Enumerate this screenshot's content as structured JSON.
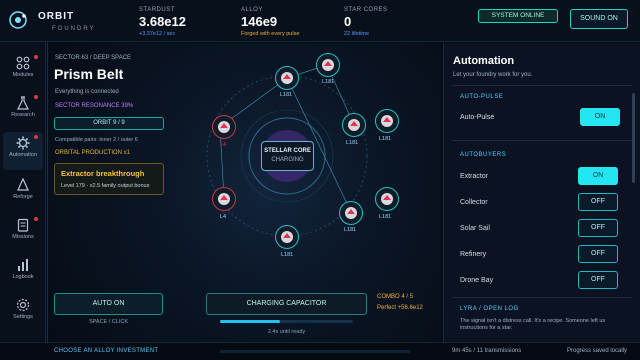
{
  "brand": {
    "name": "ORBIT",
    "subtitle": "FOUNDRY"
  },
  "stats": [
    {
      "label": "STARDUST",
      "value": "3.68e12",
      "sub": "+3.37e12 / sec",
      "sub_color": "#4f9bff"
    },
    {
      "label": "ALLOY",
      "value": "146e9",
      "sub": "Forged with every pulse",
      "sub_color": "#f0b13c"
    },
    {
      "label": "STAR CORES",
      "value": "0",
      "sub": "22 lifetime",
      "sub_color": "#4f9bff"
    }
  ],
  "header_buttons": {
    "status": "SYSTEM ONLINE",
    "sound": "SOUND ON"
  },
  "nav": [
    {
      "label": "Modules",
      "icon": "grid-icon",
      "badge": true
    },
    {
      "label": "Research",
      "icon": "flask-icon",
      "badge": true
    },
    {
      "label": "Automation",
      "icon": "gear-icon",
      "badge": true
    },
    {
      "label": "Reforge",
      "icon": "reforge-icon",
      "badge": false
    },
    {
      "label": "Missions",
      "icon": "clipboard-icon",
      "badge": true
    },
    {
      "label": "Logbook",
      "icon": "bar-chart-icon",
      "badge": false
    },
    {
      "label": "Settings",
      "icon": "settings-icon",
      "badge": false
    }
  ],
  "sector": {
    "label": "SECTOR 63 / DEEP SPACE",
    "title": "Prism Belt",
    "status": "Everything is connected",
    "resonance": "SECTOR RESONANCE 39%",
    "orbit_button": "ORBIT 9 / 9",
    "compat": "Compatible pairs: inner 2 / outer 6",
    "production": "ORBITAL PRODUCTION x1"
  },
  "breakthrough": {
    "title": "Extractor breakthrough",
    "detail": "Level 179 · x2.5 family output bonus"
  },
  "core": {
    "title": "STELLAR CORE",
    "state": "CHARGING"
  },
  "modules": [
    {
      "level": "L181"
    },
    {
      "level": "L181"
    },
    {
      "level": "L181"
    },
    {
      "level": "L181"
    },
    {
      "level": "L181"
    },
    {
      "level": "L181"
    },
    {
      "level": "L181"
    },
    {
      "level": "L4"
    },
    {
      "level": "L4"
    }
  ],
  "controls": {
    "auto": "AUTO ON",
    "hint": "SPACE / CLICK",
    "capacitor": "CHARGING CAPACITOR",
    "ready": "2.4s until ready",
    "charge_fraction": 0.45,
    "combo": "COMBO 4 / 5",
    "perfect": "Perfect +56.6e12"
  },
  "automation": {
    "title": "Automation",
    "subtitle": "Let your foundry work for you.",
    "autopulse_section": "AUTO-PULSE",
    "autopulse": {
      "label": "Auto-Pulse",
      "state": "ON"
    },
    "autobuyers_section": "AUTOBUYERS",
    "autobuyers": [
      {
        "label": "Extractor",
        "state": "ON"
      },
      {
        "label": "Collector",
        "state": "OFF"
      },
      {
        "label": "Solar Sail",
        "state": "OFF"
      },
      {
        "label": "Refinery",
        "state": "OFF"
      },
      {
        "label": "Drone Bay",
        "state": "OFF"
      }
    ],
    "openlog_section": "LYRA / OPEN LOG",
    "log_text": "The signal isn't a distress call. It's a recipe. Someone left us instructions for a star."
  },
  "footer": {
    "left": "CHOOSE AN ALLOY INVESTMENT",
    "center": "9m 45s / 11 transmissions",
    "right": "Progress saved locally"
  },
  "colors": {
    "accent": "#24e6f2",
    "alloy": "#f0b13c",
    "resonance": "#c07dff",
    "alert": "#e0383c"
  }
}
